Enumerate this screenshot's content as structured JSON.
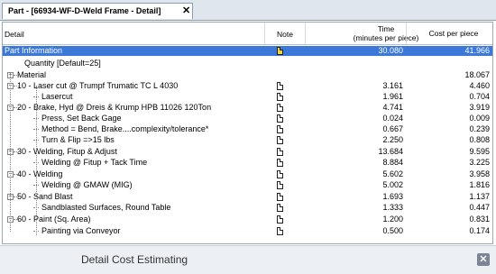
{
  "tab": {
    "title": "Part - [66934-WF-D-Weld Frame - Detail]",
    "close": "✕"
  },
  "header": {
    "detail": "Detail",
    "note": "Note",
    "time_line1": "Time",
    "time_line2": "(minutes per piece)",
    "cost": "Cost per piece"
  },
  "rows": [
    {
      "label": "Part Information",
      "note": "yellow",
      "time": "30.080",
      "cost": "41.966",
      "selected": true
    },
    {
      "label": "Quantity [Default=25]",
      "note": "",
      "time": "",
      "cost": ""
    },
    {
      "label": "Material",
      "note": "",
      "time": "",
      "cost": "18.067"
    },
    {
      "label": "10 -    Laser cut @ Trumpf Trumatic TC L 4030",
      "note": "doc",
      "time": "3.161",
      "cost": "4.460"
    },
    {
      "label": "Lasercut",
      "note": "doc",
      "time": "1.961",
      "cost": "0.704"
    },
    {
      "label": "20 -    Brake, Hyd @ Dreis & Krump HPB 11026 120Ton",
      "note": "doc",
      "time": "4.741",
      "cost": "3.919"
    },
    {
      "label": "Press, Set Back Gage",
      "note": "doc",
      "time": "0.024",
      "cost": "0.009"
    },
    {
      "label": "Method = Bend, Brake....complexity/tolerance*",
      "note": "doc",
      "time": "0.667",
      "cost": "0.239"
    },
    {
      "label": "Turn & Flip =>15 lbs",
      "note": "doc",
      "time": "2.250",
      "cost": "0.808"
    },
    {
      "label": "30 -    Welding, Fitup & Adjust",
      "note": "doc",
      "time": "13.684",
      "cost": "9.595"
    },
    {
      "label": "Welding @  Fitup + Tack Time",
      "note": "doc",
      "time": "8.884",
      "cost": "3.225"
    },
    {
      "label": "40 -    Welding",
      "note": "doc",
      "time": "5.602",
      "cost": "3.958"
    },
    {
      "label": "Welding @ GMAW  (MIG)",
      "note": "doc",
      "time": "5.002",
      "cost": "1.816"
    },
    {
      "label": "50 -    Sand Blast",
      "note": "doc",
      "time": "1.693",
      "cost": "1.137"
    },
    {
      "label": "Sandblasted Surfaces, Round Table",
      "note": "doc",
      "time": "1.333",
      "cost": "0.447"
    },
    {
      "label": "60 -    Paint (Sq. Area)",
      "note": "doc",
      "time": "1.200",
      "cost": "0.831"
    },
    {
      "label": "Painting via Conveyor",
      "note": "doc",
      "time": "0.500",
      "cost": "0.174"
    }
  ],
  "expanders": {
    "collapsed": "+",
    "expanded": "−"
  },
  "footer": {
    "title": "Detail Cost Estimating",
    "close": "✕"
  }
}
